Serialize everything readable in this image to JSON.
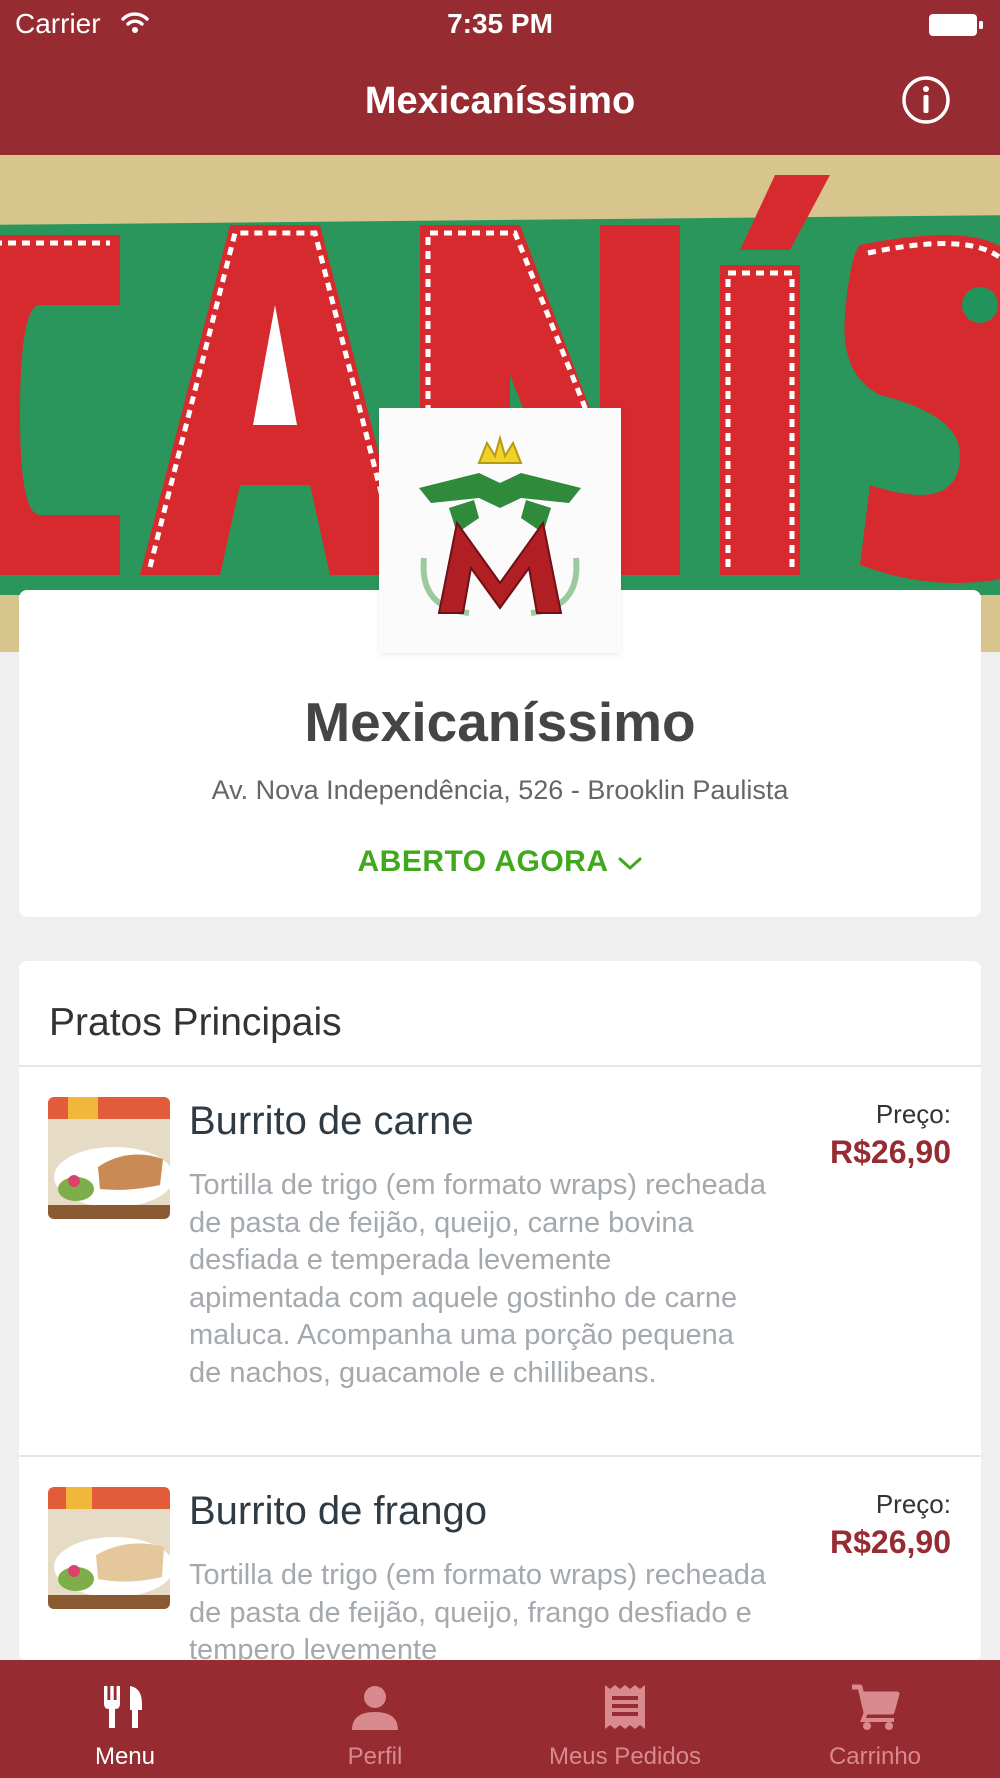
{
  "status_bar": {
    "carrier": "Carrier",
    "time": "7:35 PM"
  },
  "nav": {
    "title": "Mexicaníssimo",
    "info_icon": "info-icon"
  },
  "restaurant": {
    "name": "Mexicaníssimo",
    "address": "Av. Nova Independência, 526 - Brooklin Paulista",
    "status": "ABERTO AGORA"
  },
  "menu": {
    "section_title": "Pratos Principais",
    "items": [
      {
        "name": "Burrito de carne",
        "description": "Tortilla de trigo (em formato wraps) recheada de pasta de feijão, queijo, carne bovina desfiada e temperada levemente apimentada com aquele gostinho de carne maluca. Acompanha uma porção pequena de nachos, guacamole e chillibeans.",
        "price_label": "Preço:",
        "price": "R$26,90"
      },
      {
        "name": "Burrito de frango",
        "description": "Tortilla de trigo (em formato wraps) recheada de pasta de feijão, queijo, frango desfiado e tempero levemente",
        "price_label": "Preço:",
        "price": "R$26,90"
      }
    ]
  },
  "tabbar": {
    "tabs": [
      {
        "label": "Menu",
        "icon": "fork-knife-icon",
        "active": true
      },
      {
        "label": "Perfil",
        "icon": "person-icon",
        "active": false
      },
      {
        "label": "Meus Pedidos",
        "icon": "receipt-icon",
        "active": false
      },
      {
        "label": "Carrinho",
        "icon": "cart-icon",
        "active": false
      }
    ]
  },
  "colors": {
    "brand": "#962b31",
    "open_status": "#3fa81c",
    "price": "#962b31",
    "tab_inactive": "#d88a8f"
  }
}
